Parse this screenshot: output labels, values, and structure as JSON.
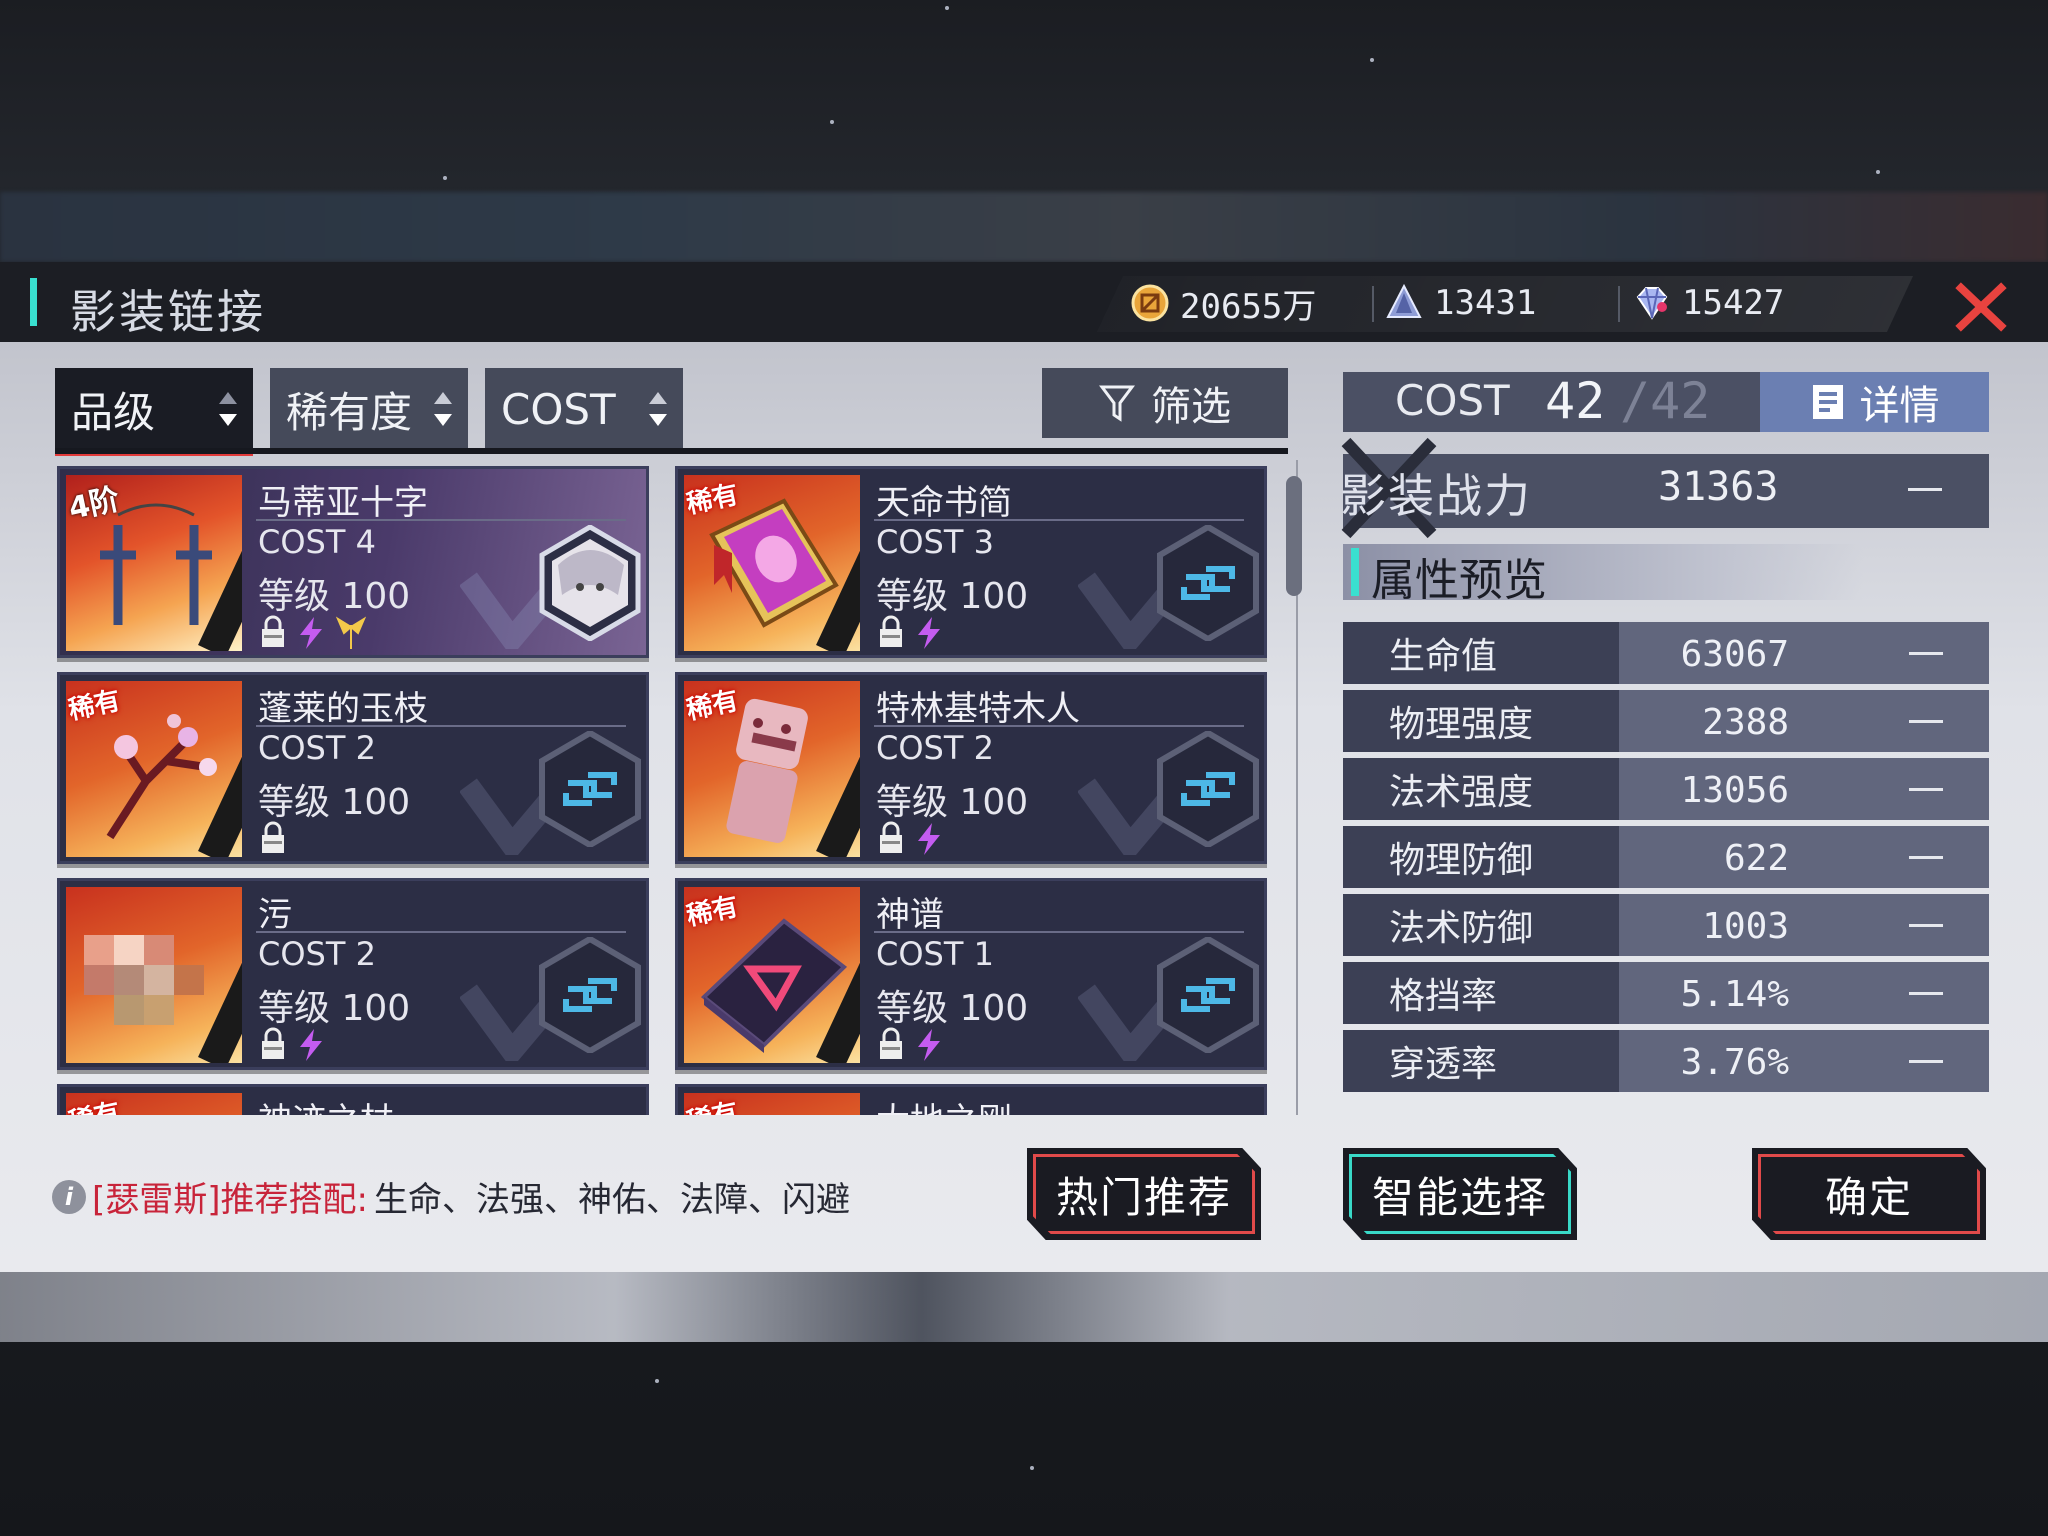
{
  "header": {
    "title": "影装链接",
    "currencies": [
      {
        "icon": "gold-coin-icon",
        "value": "20655万"
      },
      {
        "icon": "crystal-shard-icon",
        "value": "13431"
      },
      {
        "icon": "diamond-icon",
        "value": "15427"
      }
    ],
    "close_icon": "close-icon"
  },
  "sort": {
    "tabs": [
      {
        "label": "品级",
        "active": true
      },
      {
        "label": "稀有度",
        "active": false
      },
      {
        "label": "COST",
        "active": false
      }
    ],
    "filter_label": "筛选"
  },
  "cards": [
    {
      "name": "马蒂亚十字",
      "cost": "COST 4",
      "level": "等级 100",
      "badge": "4阶",
      "selected": true
    },
    {
      "name": "天命书简",
      "cost": "COST 3",
      "level": "等级 100",
      "badge": "稀有",
      "selected": false
    },
    {
      "name": "蓬莱的玉枝",
      "cost": "COST 2",
      "level": "等级 100",
      "badge": "稀有",
      "selected": false
    },
    {
      "name": "特林基特木人",
      "cost": "COST 2",
      "level": "等级 100",
      "badge": "稀有",
      "selected": false
    },
    {
      "name": "污",
      "cost": "COST 2",
      "level": "等级 100",
      "badge": "",
      "selected": false
    },
    {
      "name": "神谱",
      "cost": "COST 1",
      "level": "等级 100",
      "badge": "稀有",
      "selected": false
    },
    {
      "name": "神迹之杖",
      "cost": "",
      "level": "",
      "badge": "稀有",
      "selected": false
    },
    {
      "name": "大地之刚",
      "cost": "",
      "level": "",
      "badge": "稀有",
      "selected": false
    }
  ],
  "cost_summary": {
    "label": "COST",
    "current": "42",
    "max": "/42",
    "detail_label": "详情"
  },
  "power": {
    "label": "影装战力",
    "value": "31363"
  },
  "attributes": {
    "title": "属性预览",
    "rows": [
      {
        "name": "生命值",
        "value": "63067"
      },
      {
        "name": "物理强度",
        "value": "2388"
      },
      {
        "name": "法术强度",
        "value": "13056"
      },
      {
        "name": "物理防御",
        "value": "622"
      },
      {
        "name": "法术防御",
        "value": "1003"
      },
      {
        "name": "格挡率",
        "value": "5.14%"
      },
      {
        "name": "穿透率",
        "value": "3.76%"
      }
    ]
  },
  "recommendation": {
    "hero": "[瑟雷斯]推荐搭配:",
    "items": "生命、法强、神佑、法障、闪避"
  },
  "buttons": {
    "hot": "热门推荐",
    "smart": "智能选择",
    "confirm": "确定"
  },
  "colors": {
    "accent_teal": "#39e0d0",
    "accent_red": "#e14a4a",
    "card_bg": "#2c2e45"
  }
}
